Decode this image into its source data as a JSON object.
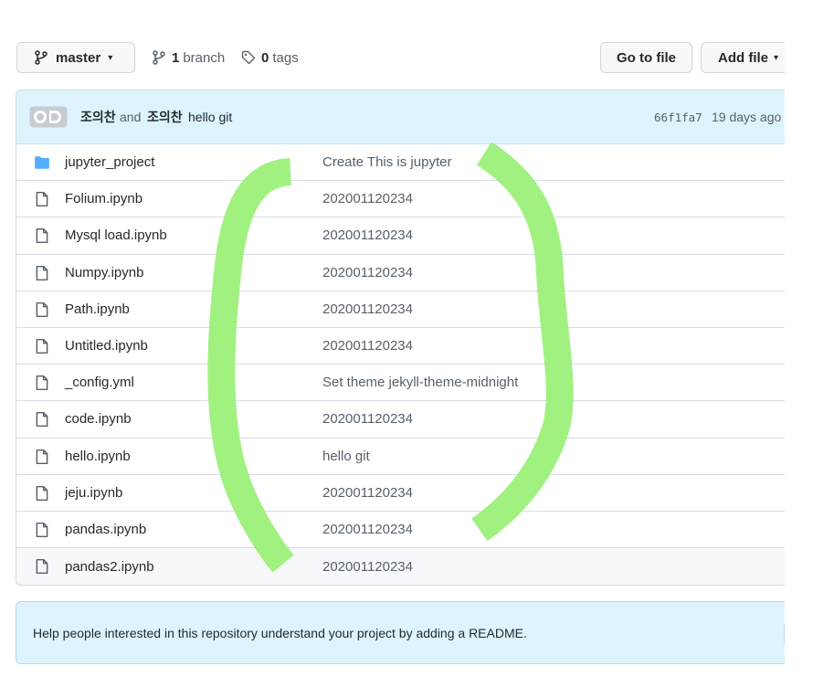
{
  "toolbar": {
    "branch_label": "master",
    "branches_count": "1",
    "branches_label": "branch",
    "tags_count": "0",
    "tags_label": "tags",
    "go_to_file_label": "Go to file",
    "add_file_label": "Add file"
  },
  "commit": {
    "author": "조의찬",
    "and_text": "and",
    "coauthor": "조의찬",
    "message": "hello git",
    "sha": "66f1fa7",
    "age": "19 days ago"
  },
  "files": [
    {
      "name": "jupyter_project",
      "type": "folder",
      "message": "Create This is jupyter"
    },
    {
      "name": "Folium.ipynb",
      "type": "file",
      "message": "202001120234"
    },
    {
      "name": "Mysql load.ipynb",
      "type": "file",
      "message": "202001120234"
    },
    {
      "name": "Numpy.ipynb",
      "type": "file",
      "message": "202001120234"
    },
    {
      "name": "Path.ipynb",
      "type": "file",
      "message": "202001120234"
    },
    {
      "name": "Untitled.ipynb",
      "type": "file",
      "message": "202001120234"
    },
    {
      "name": "_config.yml",
      "type": "file",
      "message": "Set theme jekyll-theme-midnight"
    },
    {
      "name": "code.ipynb",
      "type": "file",
      "message": "202001120234"
    },
    {
      "name": "hello.ipynb",
      "type": "file",
      "message": "hello git"
    },
    {
      "name": "jeju.ipynb",
      "type": "file",
      "message": "202001120234"
    },
    {
      "name": "pandas.ipynb",
      "type": "file",
      "message": "202001120234"
    },
    {
      "name": "pandas2.ipynb",
      "type": "file",
      "message": "202001120234"
    }
  ],
  "readme_prompt": "Help people interested in this repository understand your project by adding a README.",
  "icons": {
    "branch": "git-branch-icon",
    "tag": "tag-icon",
    "folder": "folder-icon",
    "file": "file-icon",
    "caret": "triangle-down-icon"
  },
  "colors": {
    "folder": "#54aeff",
    "commit_bar": "#ddf4ff",
    "annotation": "#9cf07a"
  }
}
